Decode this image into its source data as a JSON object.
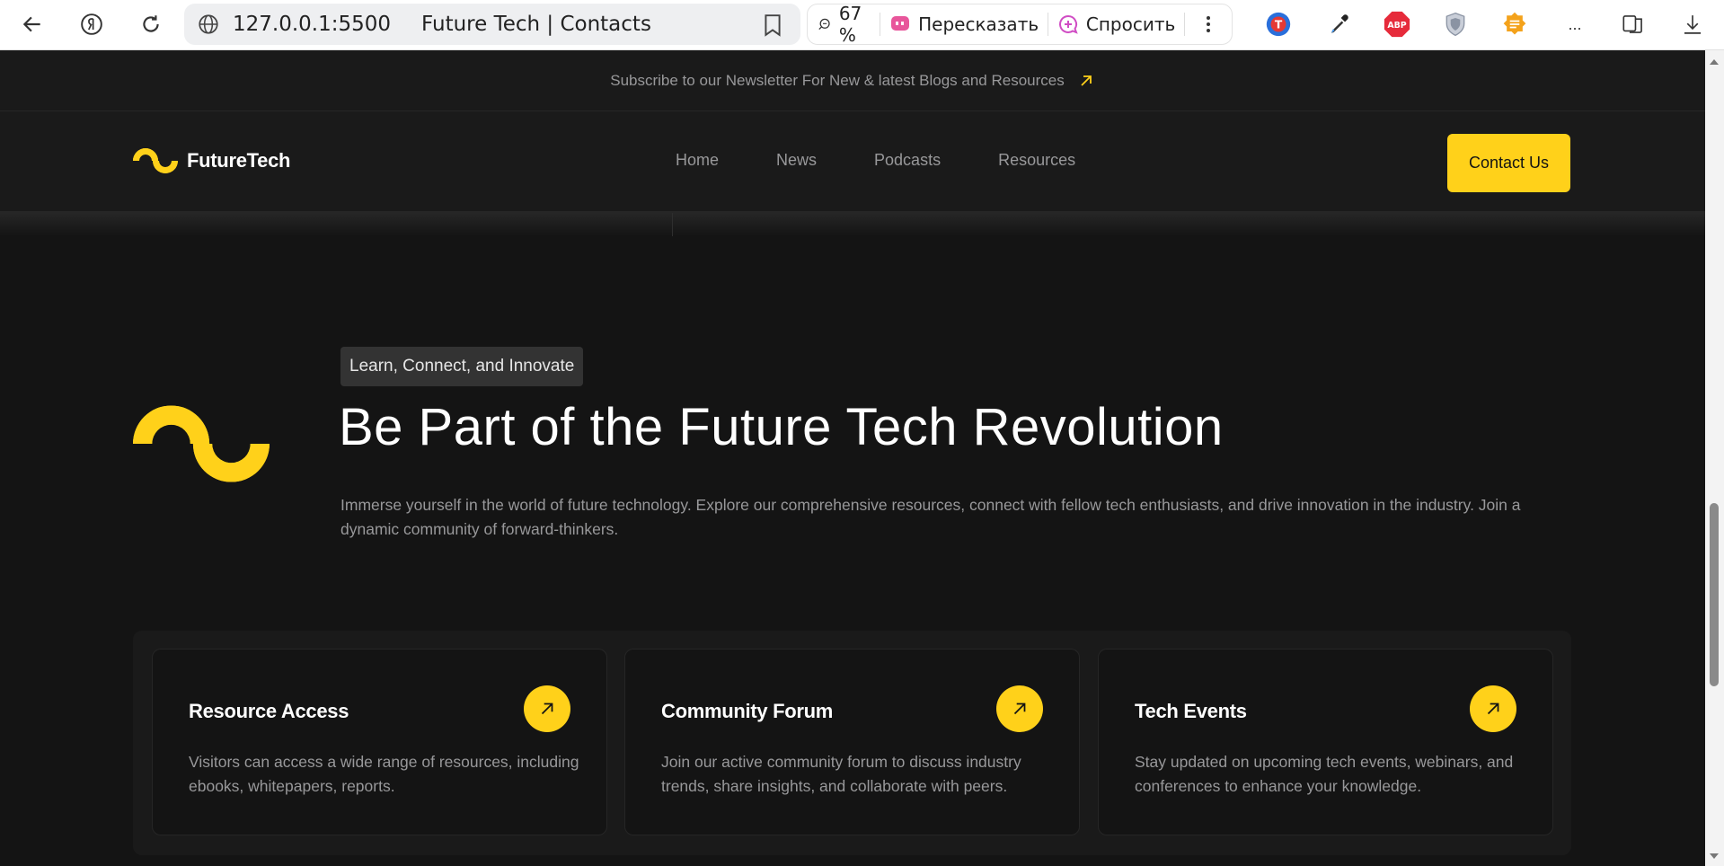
{
  "browser": {
    "url": "127.0.0.1:5500",
    "tab_title": "Future Tech | Contacts",
    "zoom": "67 %",
    "retell_label": "Пересказать",
    "ask_label": "Спросить",
    "more_label": "...",
    "extensions": [
      "translate-icon",
      "eyedropper-icon",
      "adblock-icon",
      "shield-icon",
      "notes-icon"
    ],
    "abp_text": "ABP"
  },
  "site": {
    "newsletter": "Subscribe to our Newsletter For New & latest Blogs and Resources",
    "brand": "FutureTech",
    "nav": [
      {
        "label": "Home"
      },
      {
        "label": "News"
      },
      {
        "label": "Podcasts"
      },
      {
        "label": "Resources"
      }
    ],
    "contact_button": "Contact Us",
    "hero": {
      "tag": "Learn, Connect, and Innovate",
      "title": "Be Part of the Future Tech Revolution",
      "description": "Immerse yourself in the world of future technology. Explore our comprehensive resources, connect with fellow tech enthusiasts, and drive innovation in the industry. Join a dynamic community of forward-thinkers."
    },
    "cards": [
      {
        "title": "Resource Access",
        "description": "Visitors can access a wide range of resources, including ebooks, whitepapers, reports."
      },
      {
        "title": "Community Forum",
        "description": "Join our active community forum to discuss industry trends, share insights, and collaborate with peers."
      },
      {
        "title": "Tech Events",
        "description": "Stay updated on upcoming tech events, webinars, and conferences to enhance your knowledge."
      }
    ],
    "accent_color": "#ffd11a"
  }
}
